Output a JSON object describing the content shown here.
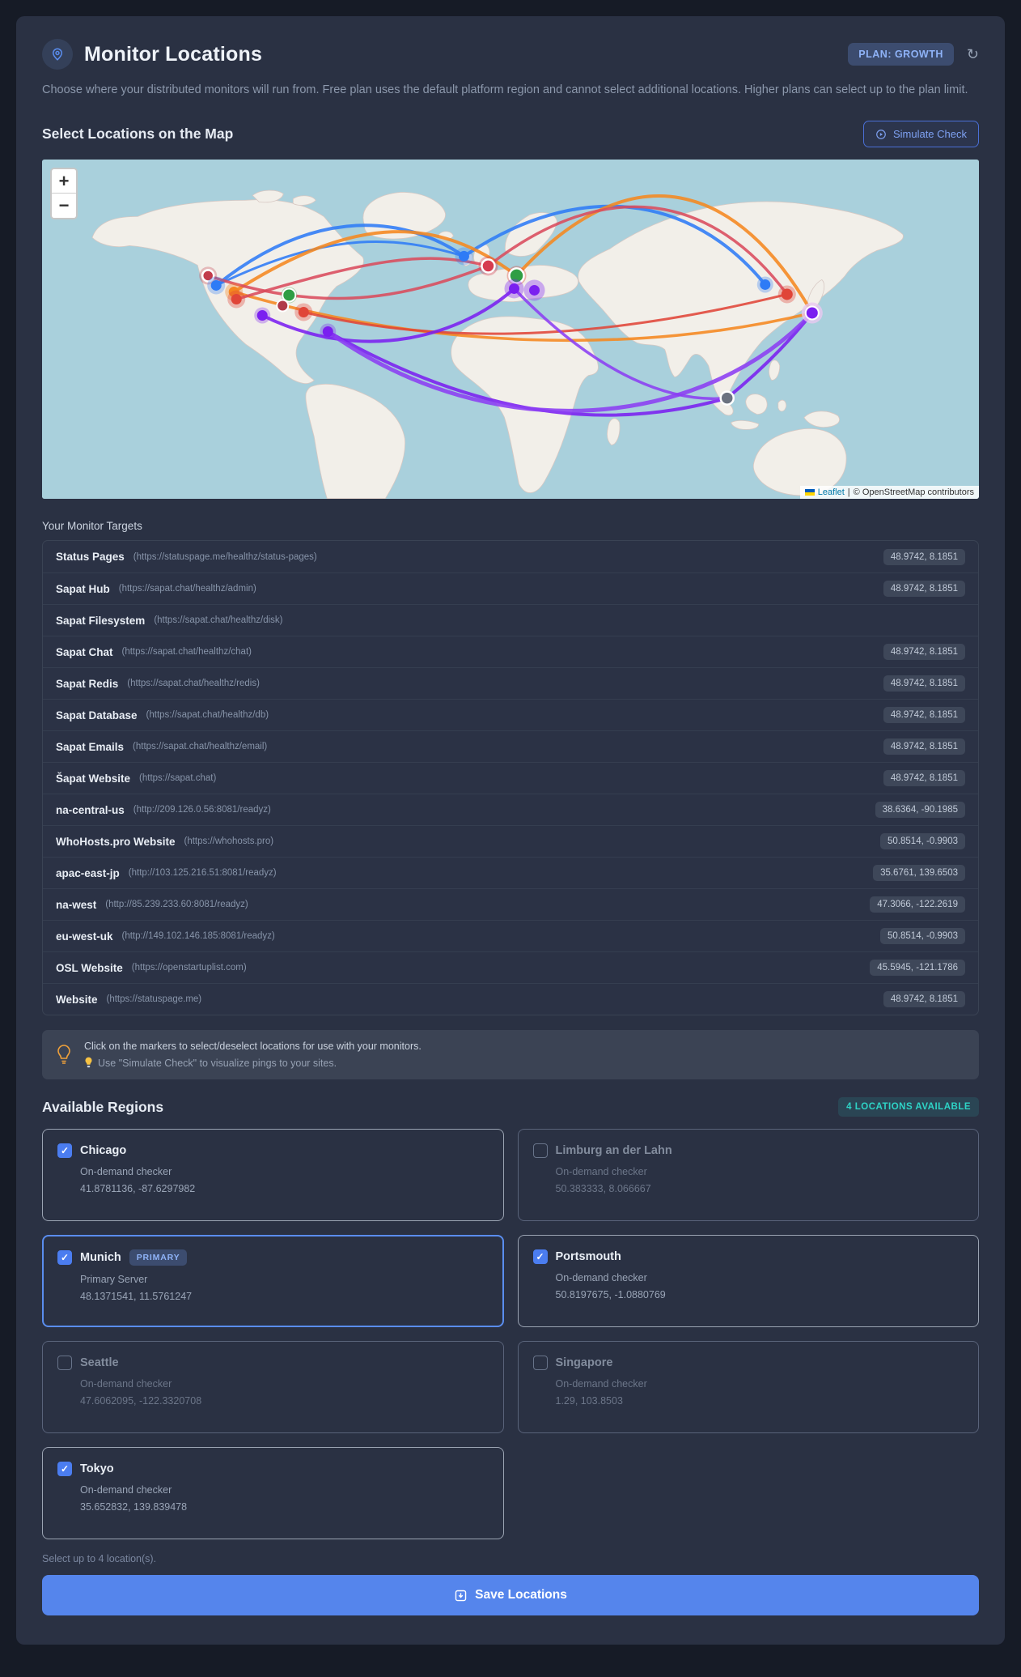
{
  "header": {
    "title": "Monitor Locations",
    "plan_badge": "PLAN: GROWTH",
    "description": "Choose where your distributed monitors will run from. Free plan uses the default platform region and cannot select additional locations. Higher plans can select up to the plan limit."
  },
  "map_section": {
    "heading": "Select Locations on the Map",
    "simulate_button": "Simulate Check",
    "zoom_in": "+",
    "zoom_out": "−",
    "attribution": {
      "leaflet": "Leaflet",
      "separator": "|",
      "osm": "© OpenStreetMap contributors"
    },
    "marker_colors": {
      "blue": "#2e7bf6",
      "orange": "#f5871f",
      "red": "#e04538",
      "crimson": "#c23b4b",
      "green": "#2f9e44",
      "purple": "#7a1ff0",
      "violet": "#8b3df2",
      "gray": "#6b7280"
    }
  },
  "targets": {
    "heading": "Your Monitor Targets",
    "rows": [
      {
        "name": "Status Pages",
        "url": "(https://statuspage.me/healthz/status-pages)",
        "coords": "48.9742, 8.1851"
      },
      {
        "name": "Sapat Hub",
        "url": "(https://sapat.chat/healthz/admin)",
        "coords": "48.9742, 8.1851"
      },
      {
        "name": "Sapat Filesystem",
        "url": "(https://sapat.chat/healthz/disk)",
        "coords": ""
      },
      {
        "name": "Sapat Chat",
        "url": "(https://sapat.chat/healthz/chat)",
        "coords": "48.9742, 8.1851"
      },
      {
        "name": "Sapat Redis",
        "url": "(https://sapat.chat/healthz/redis)",
        "coords": "48.9742, 8.1851"
      },
      {
        "name": "Sapat Database",
        "url": "(https://sapat.chat/healthz/db)",
        "coords": "48.9742, 8.1851"
      },
      {
        "name": "Sapat Emails",
        "url": "(https://sapat.chat/healthz/email)",
        "coords": "48.9742, 8.1851"
      },
      {
        "name": "Šapat Website",
        "url": "(https://sapat.chat)",
        "coords": "48.9742, 8.1851"
      },
      {
        "name": "na-central-us",
        "url": "(http://209.126.0.56:8081/readyz)",
        "coords": "38.6364, -90.1985"
      },
      {
        "name": "WhoHosts.pro Website",
        "url": "(https://whohosts.pro)",
        "coords": "50.8514, -0.9903"
      },
      {
        "name": "apac-east-jp",
        "url": "(http://103.125.216.51:8081/readyz)",
        "coords": "35.6761, 139.6503"
      },
      {
        "name": "na-west",
        "url": "(http://85.239.233.60:8081/readyz)",
        "coords": "47.3066, -122.2619"
      },
      {
        "name": "eu-west-uk",
        "url": "(http://149.102.146.185:8081/readyz)",
        "coords": "50.8514, -0.9903"
      },
      {
        "name": "OSL Website",
        "url": "(https://openstartuplist.com)",
        "coords": "45.5945, -121.1786"
      },
      {
        "name": "Website",
        "url": "(https://statuspage.me)",
        "coords": "48.9742, 8.1851"
      }
    ]
  },
  "tip": {
    "line1": "Click on the markers to select/deselect locations for use with your monitors.",
    "line2": "Use \"Simulate Check\" to visualize pings to your sites."
  },
  "regions": {
    "heading": "Available Regions",
    "badge": "4 LOCATIONS AVAILABLE",
    "cards": [
      {
        "name": "Chicago",
        "subtitle": "On-demand checker",
        "coords": "41.8781136, -87.6297982",
        "checked": true,
        "primary": false
      },
      {
        "name": "Limburg an der Lahn",
        "subtitle": "On-demand checker",
        "coords": "50.383333, 8.066667",
        "checked": false,
        "primary": false
      },
      {
        "name": "Munich",
        "badge": "PRIMARY",
        "subtitle": "Primary Server",
        "coords": "48.1371541, 11.5761247",
        "checked": true,
        "primary": true
      },
      {
        "name": "Portsmouth",
        "subtitle": "On-demand checker",
        "coords": "50.8197675, -1.0880769",
        "checked": true,
        "primary": false
      },
      {
        "name": "Seattle",
        "subtitle": "On-demand checker",
        "coords": "47.6062095, -122.3320708",
        "checked": false,
        "primary": false
      },
      {
        "name": "Singapore",
        "subtitle": "On-demand checker",
        "coords": "1.29, 103.8503",
        "checked": false,
        "primary": false
      },
      {
        "name": "Tokyo",
        "subtitle": "On-demand checker",
        "coords": "35.652832, 139.839478",
        "checked": true,
        "primary": false
      }
    ],
    "footnote": "Select up to 4 location(s)."
  },
  "save_button": "Save Locations",
  "icons": {
    "header": "location-pin-icon",
    "refresh": "refresh-icon",
    "simulate": "play-circle-icon",
    "tip": "lightbulb-icon",
    "tip_inline": "bulb-emoji-icon",
    "save": "save-tray-icon"
  },
  "colors": {
    "page_bg": "#161b26",
    "card_bg": "#2a3143",
    "accent_blue": "#5585ec",
    "plan_badge_text": "#8fb3f8",
    "teal": "#2ed3c6",
    "map_water": "#a9d0dc",
    "map_land": "#f2efe9"
  }
}
